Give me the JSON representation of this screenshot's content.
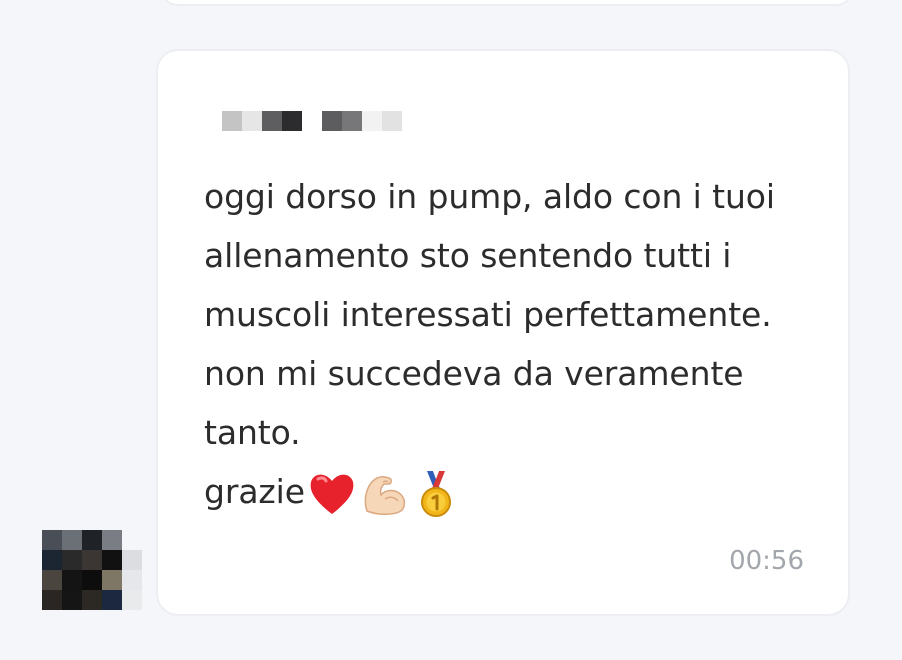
{
  "message": {
    "sender_name_redacted": "pixelated sender name",
    "lines": [
      "oggi dorso in pump, aldo con i tuoi",
      "allenamento sto sentendo tutti i",
      "muscoli interessati perfettamente.",
      "non mi succedeva da veramente",
      "tanto.",
      "grazie"
    ],
    "emojis": [
      "red-heart",
      "flexed-biceps",
      "first-place-medal"
    ],
    "time": "00:56"
  },
  "colors": {
    "background": "#f4f6f9",
    "bubble": "#ffffff",
    "bubble_border": "#eceef2",
    "text": "#2c2c2c",
    "time": "#a3a7ad"
  }
}
